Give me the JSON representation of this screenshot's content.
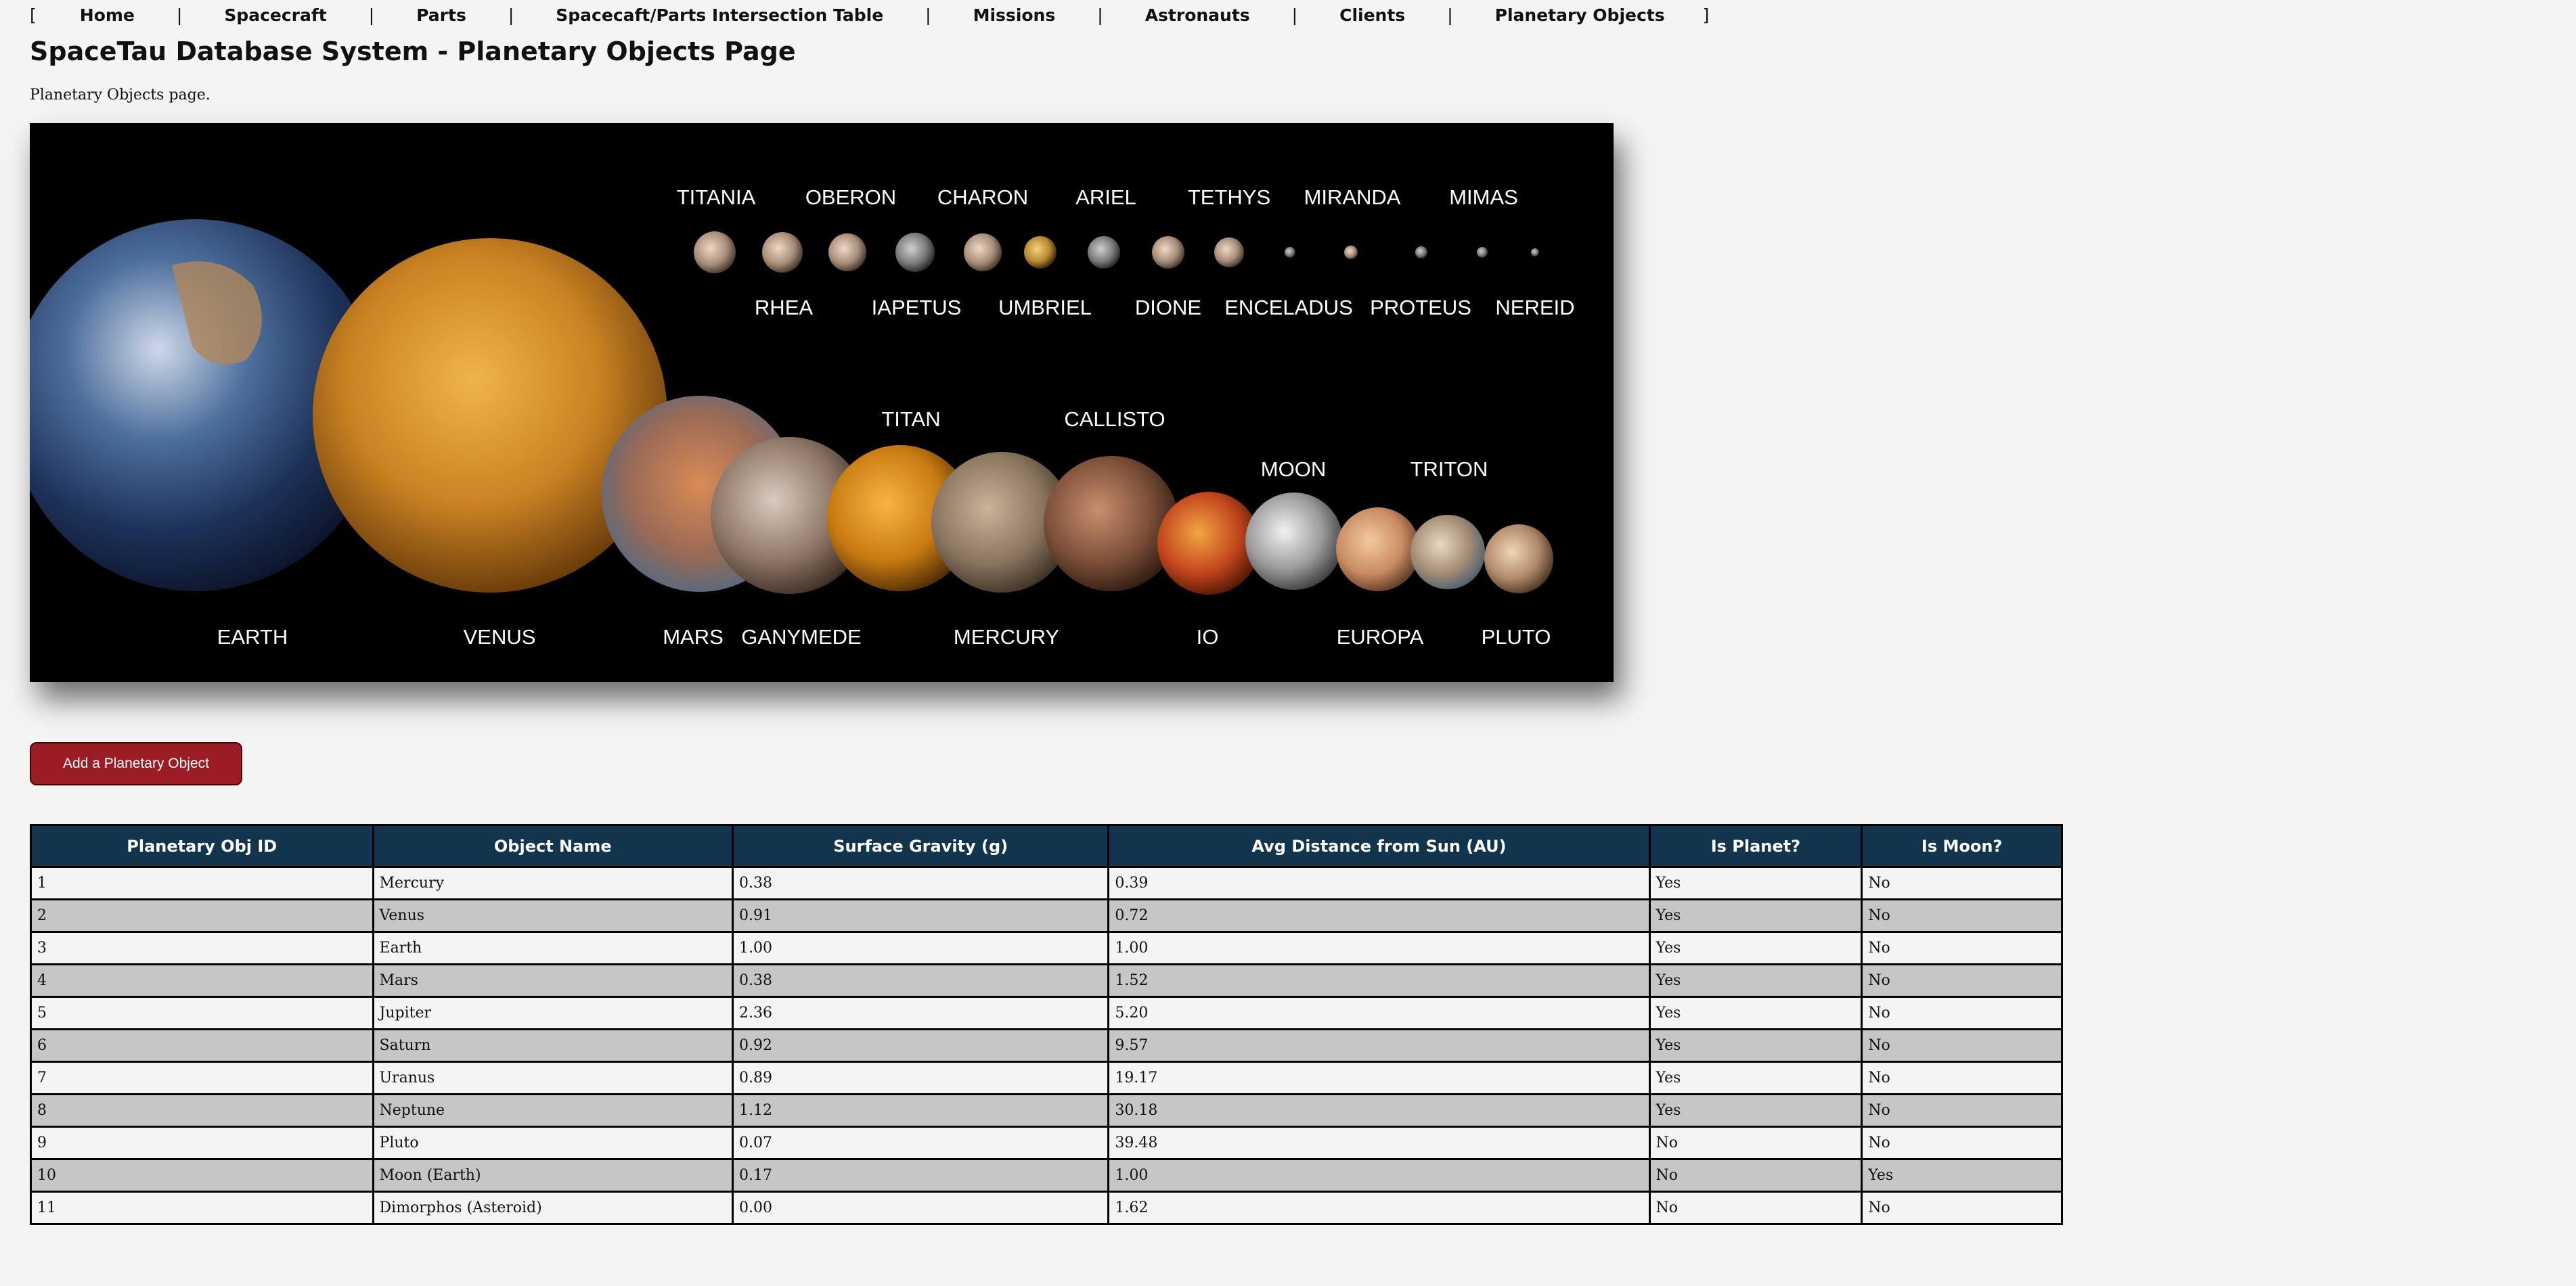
{
  "nav": {
    "open_bracket": "[",
    "close_bracket": "]",
    "separator": "|",
    "items": [
      "Home",
      "Spacecraft",
      "Parts",
      "Spacecaft/Parts Intersection Table",
      "Missions",
      "Astronauts",
      "Clients",
      "Planetary Objects"
    ]
  },
  "page": {
    "title": "SpaceTau Database System - Planetary Objects Page",
    "subtitle": "Planetary Objects page."
  },
  "banner": {
    "top_row_labels": [
      "TITANIA",
      "OBERON",
      "CHARON",
      "ARIEL",
      "TETHYS",
      "MIRANDA",
      "MIMAS"
    ],
    "second_row_labels": [
      "RHEA",
      "IAPETUS",
      "UMBRIEL",
      "DIONE",
      "ENCELADUS",
      "PROTEUS",
      "NEREID"
    ],
    "mid_labels": [
      "TITAN",
      "CALLISTO",
      "MOON",
      "TRITON"
    ],
    "bottom_labels": [
      "EARTH",
      "VENUS",
      "MARS",
      "GANYMEDE",
      "MERCURY",
      "IO",
      "EUROPA",
      "PLUTO"
    ]
  },
  "actions": {
    "add_label": "Add a Planetary Object"
  },
  "table": {
    "headers": [
      "Planetary Obj ID",
      "Object Name",
      "Surface Gravity (g)",
      "Avg Distance from Sun (AU)",
      "Is Planet?",
      "Is Moon?"
    ],
    "rows": [
      [
        "1",
        "Mercury",
        "0.38",
        "0.39",
        "Yes",
        "No"
      ],
      [
        "2",
        "Venus",
        "0.91",
        "0.72",
        "Yes",
        "No"
      ],
      [
        "3",
        "Earth",
        "1.00",
        "1.00",
        "Yes",
        "No"
      ],
      [
        "4",
        "Mars",
        "0.38",
        "1.52",
        "Yes",
        "No"
      ],
      [
        "5",
        "Jupiter",
        "2.36",
        "5.20",
        "Yes",
        "No"
      ],
      [
        "6",
        "Saturn",
        "0.92",
        "9.57",
        "Yes",
        "No"
      ],
      [
        "7",
        "Uranus",
        "0.89",
        "19.17",
        "Yes",
        "No"
      ],
      [
        "8",
        "Neptune",
        "1.12",
        "30.18",
        "Yes",
        "No"
      ],
      [
        "9",
        "Pluto",
        "0.07",
        "39.48",
        "No",
        "No"
      ],
      [
        "10",
        "Moon (Earth)",
        "0.17",
        "1.00",
        "No",
        "Yes"
      ],
      [
        "11",
        "Dimorphos (Asteroid)",
        "0.00",
        "1.62",
        "No",
        "No"
      ]
    ]
  }
}
